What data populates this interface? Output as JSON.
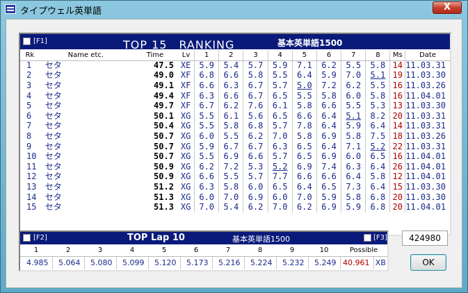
{
  "window": {
    "title": "タイプウェル英単語",
    "close_label": "X"
  },
  "ranking": {
    "fkey": "[F1]",
    "title": "TOP 15　RANKING",
    "subtitle": "基本英単語1500",
    "columns": [
      "Rk",
      "Name etc.",
      "Time",
      "Lv",
      "1",
      "2",
      "3",
      "4",
      "5",
      "6",
      "7",
      "8",
      "Ms",
      "Date"
    ],
    "rows": [
      {
        "rk": "1",
        "name": "セタ",
        "time": "47.5",
        "lv": "XE",
        "laps": [
          "5.9",
          "5.4",
          "5.7",
          "5.9",
          "7.1",
          "6.2",
          "5.5",
          "5.8"
        ],
        "ms": "14",
        "date": "11.03.31",
        "ul": []
      },
      {
        "rk": "2",
        "name": "セタ",
        "time": "49.0",
        "lv": "XF",
        "laps": [
          "6.8",
          "6.6",
          "5.8",
          "5.5",
          "6.4",
          "5.9",
          "7.0",
          "5.1"
        ],
        "ms": "19",
        "date": "11.03.30",
        "ul": [
          7
        ]
      },
      {
        "rk": "3",
        "name": "セタ",
        "time": "49.1",
        "lv": "XF",
        "laps": [
          "6.6",
          "6.3",
          "6.7",
          "5.7",
          "5.0",
          "7.2",
          "6.2",
          "5.5"
        ],
        "ms": "16",
        "date": "11.03.26",
        "ul": [
          4
        ]
      },
      {
        "rk": "4",
        "name": "セタ",
        "time": "49.4",
        "lv": "XF",
        "laps": [
          "6.3",
          "6.6",
          "6.7",
          "6.5",
          "5.5",
          "5.8",
          "6.0",
          "5.8"
        ],
        "ms": "16",
        "date": "11.04.01",
        "ul": []
      },
      {
        "rk": "5",
        "name": "セタ",
        "time": "49.7",
        "lv": "XF",
        "laps": [
          "6.7",
          "6.2",
          "7.6",
          "6.1",
          "5.8",
          "6.6",
          "5.5",
          "5.3"
        ],
        "ms": "13",
        "date": "11.03.30",
        "ul": []
      },
      {
        "rk": "6",
        "name": "セタ",
        "time": "50.1",
        "lv": "XG",
        "laps": [
          "5.5",
          "6.1",
          "5.6",
          "6.5",
          "6.6",
          "6.4",
          "5.1",
          "8.2"
        ],
        "ms": "20",
        "date": "11.03.31",
        "ul": [
          6
        ]
      },
      {
        "rk": "7",
        "name": "セタ",
        "time": "50.4",
        "lv": "XG",
        "laps": [
          "5.5",
          "5.8",
          "6.8",
          "5.7",
          "7.8",
          "6.4",
          "5.9",
          "6.4"
        ],
        "ms": "14",
        "date": "11.03.31",
        "ul": []
      },
      {
        "rk": "8",
        "name": "セタ",
        "time": "50.7",
        "lv": "XG",
        "laps": [
          "6.0",
          "5.5",
          "6.2",
          "7.0",
          "5.8",
          "6.9",
          "5.8",
          "7.5"
        ],
        "ms": "18",
        "date": "11.03.26",
        "ul": []
      },
      {
        "rk": "9",
        "name": "セタ",
        "time": "50.7",
        "lv": "XG",
        "laps": [
          "5.9",
          "6.7",
          "6.7",
          "6.3",
          "6.5",
          "6.4",
          "7.1",
          "5.2"
        ],
        "ms": "22",
        "date": "11.03.31",
        "ul": [
          7
        ]
      },
      {
        "rk": "10",
        "name": "セタ",
        "time": "50.7",
        "lv": "XG",
        "laps": [
          "5.5",
          "6.9",
          "6.6",
          "5.7",
          "6.5",
          "6.9",
          "6.0",
          "6.5"
        ],
        "ms": "16",
        "date": "11.04.01",
        "ul": []
      },
      {
        "rk": "11",
        "name": "セタ",
        "time": "50.9",
        "lv": "XG",
        "laps": [
          "6.2",
          "7.2",
          "5.3",
          "5.2",
          "6.9",
          "7.4",
          "6.3",
          "6.4"
        ],
        "ms": "26",
        "date": "11.04.01",
        "ul": [
          3
        ]
      },
      {
        "rk": "12",
        "name": "セタ",
        "time": "50.9",
        "lv": "XG",
        "laps": [
          "6.6",
          "5.5",
          "5.7",
          "7.7",
          "6.6",
          "6.6",
          "6.4",
          "5.8"
        ],
        "ms": "12",
        "date": "11.04.01",
        "ul": []
      },
      {
        "rk": "13",
        "name": "セタ",
        "time": "51.2",
        "lv": "XG",
        "laps": [
          "6.3",
          "5.8",
          "6.0",
          "6.5",
          "6.4",
          "6.5",
          "7.3",
          "6.4"
        ],
        "ms": "15",
        "date": "11.03.30",
        "ul": []
      },
      {
        "rk": "14",
        "name": "セタ",
        "time": "51.3",
        "lv": "XG",
        "laps": [
          "6.0",
          "7.0",
          "6.9",
          "6.0",
          "7.0",
          "5.9",
          "5.8",
          "6.8"
        ],
        "ms": "20",
        "date": "11.03.30",
        "ul": []
      },
      {
        "rk": "15",
        "name": "セタ",
        "time": "51.3",
        "lv": "XG",
        "laps": [
          "7.0",
          "5.4",
          "6.2",
          "7.0",
          "6.2",
          "6.9",
          "5.9",
          "6.8"
        ],
        "ms": "20",
        "date": "11.04.01",
        "ul": []
      }
    ]
  },
  "lap": {
    "fkey_left": "[F2]",
    "title": "TOP Lap 10",
    "subtitle": "基本英単語1500",
    "fkey_right": "[F3]",
    "columns": [
      "1",
      "2",
      "3",
      "4",
      "5",
      "6",
      "7",
      "8",
      "9",
      "10",
      "Possible"
    ],
    "values": [
      "4.985",
      "5.064",
      "5.080",
      "5.099",
      "5.120",
      "5.173",
      "5.216",
      "5.224",
      "5.232",
      "5.249",
      "40.961"
    ],
    "level": "XB"
  },
  "score": "424980",
  "ok_label": "OK"
}
